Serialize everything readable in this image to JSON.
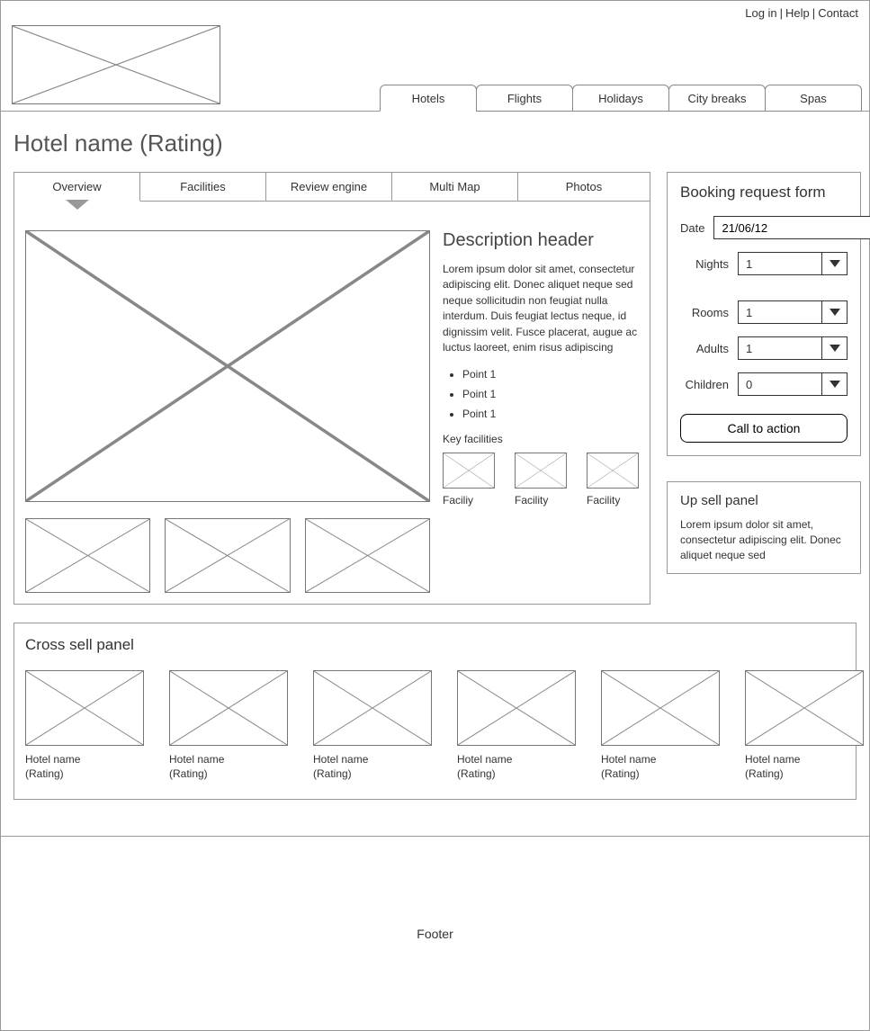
{
  "topLinks": {
    "login": "Log in",
    "help": "Help",
    "contact": "Contact"
  },
  "mainTabs": [
    "Hotels",
    "Flights",
    "Holidays",
    "City breaks",
    "Spas"
  ],
  "pageTitle": "Hotel name (Rating)",
  "subTabs": [
    "Overview",
    "Facilities",
    "Review engine",
    "Multi Map",
    "Photos"
  ],
  "description": {
    "header": "Description header",
    "body": "Lorem ipsum dolor sit amet, consectetur adipiscing elit. Donec aliquet neque sed neque sollicitudin non feugiat nulla interdum. Duis feugiat lectus neque, id dignissim velit. Fusce placerat, augue ac luctus laoreet, enim risus adipiscing",
    "points": [
      "Point 1",
      "Point 1",
      "Point 1"
    ]
  },
  "keyFacilities": {
    "label": "Key facilities",
    "items": [
      "Faciliy",
      "Facility",
      "Facility"
    ]
  },
  "booking": {
    "title": "Booking request form",
    "dateLabel": "Date",
    "dateValue": "21/06/12",
    "nightsLabel": "Nights",
    "nightsValue": "1",
    "roomsLabel": "Rooms",
    "roomsValue": "1",
    "adultsLabel": "Adults",
    "adultsValue": "1",
    "childrenLabel": "Children",
    "childrenValue": "0",
    "cta": "Call to action"
  },
  "upsell": {
    "title": "Up sell panel",
    "text": "Lorem ipsum dolor sit amet, consectetur adipiscing elit. Donec aliquet neque sed"
  },
  "crossSell": {
    "title": "Cross sell panel",
    "items": [
      {
        "name": "Hotel name",
        "rating": "(Rating)"
      },
      {
        "name": "Hotel name",
        "rating": "(Rating)"
      },
      {
        "name": "Hotel name",
        "rating": "(Rating)"
      },
      {
        "name": "Hotel name",
        "rating": "(Rating)"
      },
      {
        "name": "Hotel name",
        "rating": "(Rating)"
      },
      {
        "name": "Hotel name",
        "rating": "(Rating)"
      }
    ]
  },
  "footer": "Footer"
}
